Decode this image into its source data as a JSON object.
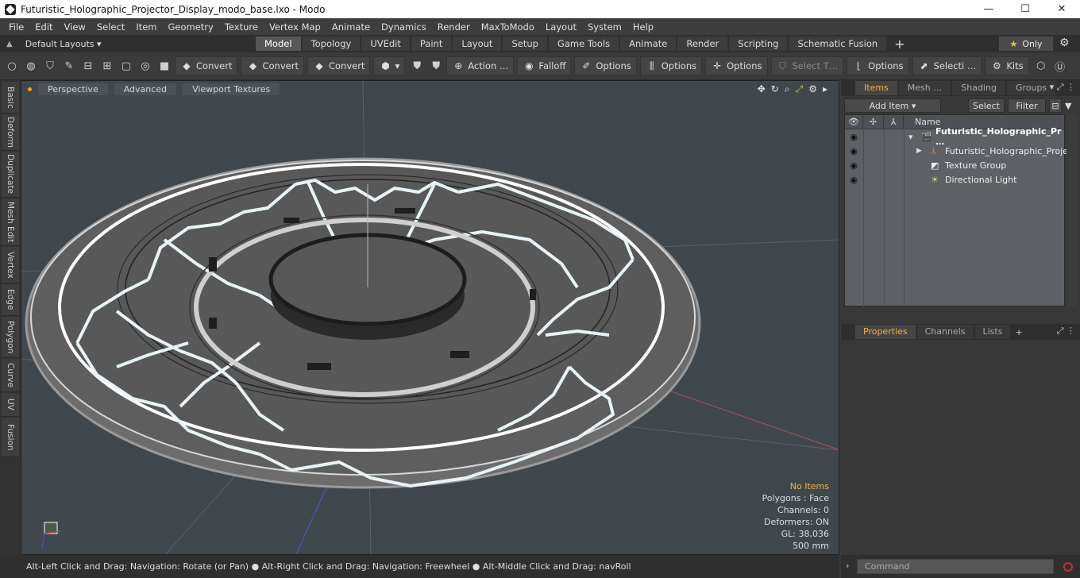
{
  "window": {
    "title": "Futuristic_Holographic_Projector_Display_modo_base.lxo - Modo",
    "minimize": "—",
    "maximize": "☐",
    "close": "✕"
  },
  "menu": [
    "File",
    "Edit",
    "View",
    "Select",
    "Item",
    "Geometry",
    "Texture",
    "Vertex Map",
    "Animate",
    "Dynamics",
    "Render",
    "MaxToModo",
    "Layout",
    "System",
    "Help"
  ],
  "layouts": {
    "label": "Default Layouts ▾"
  },
  "tabs": [
    "Model",
    "Topology",
    "UVEdit",
    "Paint",
    "Layout",
    "Setup",
    "Game Tools",
    "Animate",
    "Render",
    "Scripting",
    "Schematic Fusion"
  ],
  "active_tab": "Model",
  "only_label": "Only",
  "toolbar": {
    "convert1": "Convert",
    "convert2": "Convert",
    "convert3": "Convert",
    "action": "Action …",
    "falloff": "Falloff",
    "options1": "Options",
    "options2": "Options",
    "options3": "Options",
    "select_t": "Select T…",
    "options4": "Options",
    "selecti": "Selecti …",
    "kits": "Kits"
  },
  "left_tabs": [
    "Basic",
    "Deform",
    "Duplicate",
    "Mesh Edit",
    "Vertex",
    "Edge",
    "Polygon",
    "Curve",
    "UV",
    "Fusion"
  ],
  "viewport": {
    "perspective": "Perspective",
    "advanced": "Advanced",
    "textures": "Viewport Textures",
    "info": {
      "no_items": "No Items",
      "polygons": "Polygons : Face",
      "channels": "Channels: 0",
      "deformers": "Deformers: ON",
      "gl": "GL: 38,036",
      "scale": "500 mm"
    }
  },
  "items_panel": {
    "tabs": [
      "Items",
      "Mesh …",
      "Shading",
      "Groups"
    ],
    "add_item": "Add Item",
    "select": "Select",
    "filter": "Filter",
    "name_header": "Name",
    "rows": [
      {
        "label": "Futuristic_Holographic_Pr …"
      },
      {
        "label": "Futuristic_Holographic_Proje…"
      },
      {
        "label": "Texture Group"
      },
      {
        "label": "Directional Light"
      }
    ]
  },
  "props_panel": {
    "tabs": [
      "Properties",
      "Channels",
      "Lists"
    ]
  },
  "status": "Alt-Left Click and Drag: Navigation: Rotate (or Pan) ● Alt-Right Click and Drag: Navigation: Freewheel ● Alt-Middle Click and Drag: navRoll",
  "command": {
    "placeholder": "Command"
  }
}
